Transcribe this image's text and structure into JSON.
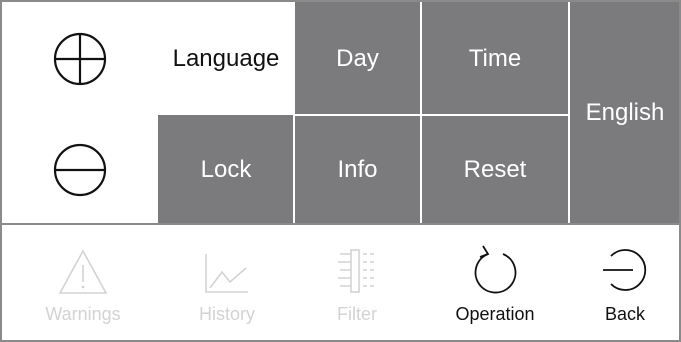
{
  "menu": {
    "language": "Language",
    "day": "Day",
    "time": "Time",
    "english": "English",
    "lock": "Lock",
    "info": "Info",
    "reset": "Reset"
  },
  "nav": {
    "warnings": "Warnings",
    "history": "History",
    "filter": "Filter",
    "operation": "Operation",
    "back": "Back"
  },
  "colors": {
    "tile": "#7b7b7d",
    "disabled": "#d3d3d3",
    "border": "#8a8a8a"
  },
  "icons": [
    "plus-circle-icon",
    "minus-circle-icon",
    "warning-triangle-icon",
    "history-chart-icon",
    "filter-icon",
    "refresh-icon",
    "back-icon"
  ]
}
